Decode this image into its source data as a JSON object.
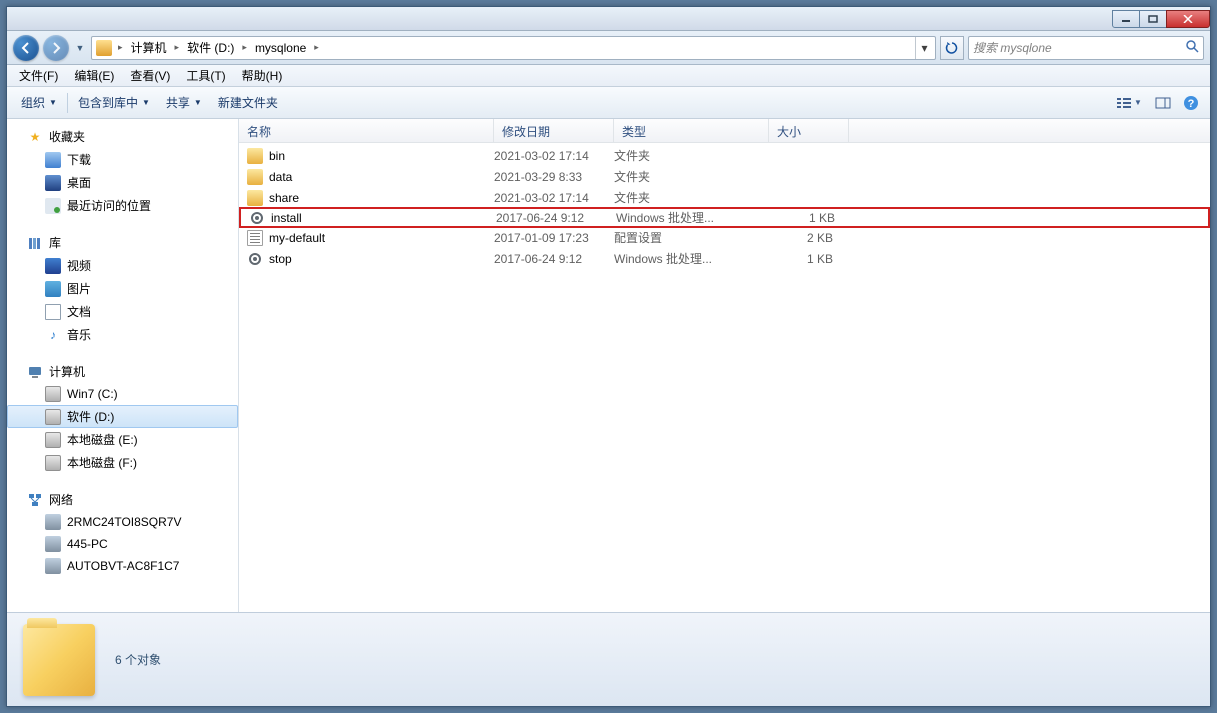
{
  "titlebar": {},
  "breadcrumb": {
    "segments": [
      "计算机",
      "软件 (D:)",
      "mysqlone"
    ]
  },
  "search": {
    "placeholder": "搜索 mysqlone"
  },
  "menubar": {
    "file": "文件(F)",
    "edit": "编辑(E)",
    "view": "查看(V)",
    "tools": "工具(T)",
    "help": "帮助(H)"
  },
  "toolbar": {
    "organize": "组织",
    "include": "包含到库中",
    "share": "共享",
    "newfolder": "新建文件夹"
  },
  "sidebar": {
    "favorites": {
      "label": "收藏夹",
      "downloads": "下载",
      "desktop": "桌面",
      "recent": "最近访问的位置"
    },
    "libraries": {
      "label": "库",
      "videos": "视频",
      "pictures": "图片",
      "documents": "文档",
      "music": "音乐"
    },
    "computer": {
      "label": "计算机",
      "c": "Win7 (C:)",
      "d": "软件 (D:)",
      "e": "本地磁盘 (E:)",
      "f": "本地磁盘 (F:)"
    },
    "network": {
      "label": "网络",
      "n1": "2RMC24TOI8SQR7V",
      "n2": "445-PC",
      "n3": "AUTOBVT-AC8F1C7"
    }
  },
  "columns": {
    "name": "名称",
    "date": "修改日期",
    "type": "类型",
    "size": "大小"
  },
  "files": [
    {
      "name": "bin",
      "date": "2021-03-02 17:14",
      "type": "文件夹",
      "size": "",
      "icon": "folder"
    },
    {
      "name": "data",
      "date": "2021-03-29 8:33",
      "type": "文件夹",
      "size": "",
      "icon": "folder"
    },
    {
      "name": "share",
      "date": "2021-03-02 17:14",
      "type": "文件夹",
      "size": "",
      "icon": "folder"
    },
    {
      "name": "install",
      "date": "2017-06-24 9:12",
      "type": "Windows 批处理...",
      "size": "1 KB",
      "icon": "gear",
      "highlighted": true
    },
    {
      "name": "my-default",
      "date": "2017-01-09 17:23",
      "type": "配置设置",
      "size": "2 KB",
      "icon": "ini"
    },
    {
      "name": "stop",
      "date": "2017-06-24 9:12",
      "type": "Windows 批处理...",
      "size": "1 KB",
      "icon": "gear"
    }
  ],
  "status": {
    "count": "6 个对象"
  }
}
